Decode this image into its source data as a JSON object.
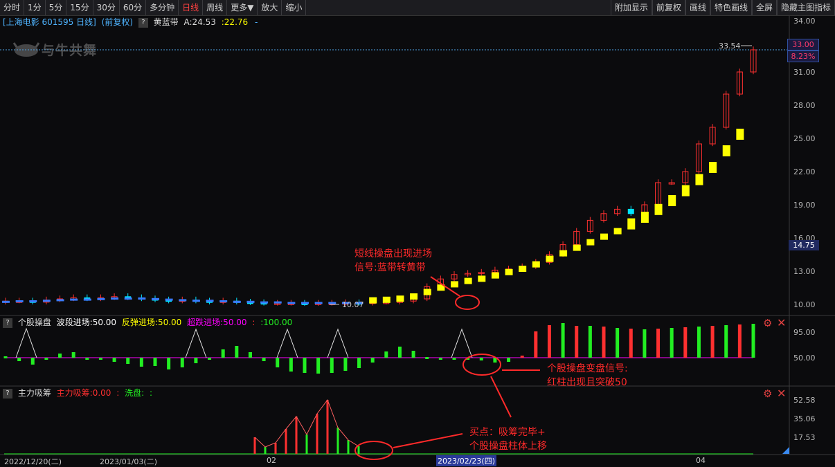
{
  "toolbar": {
    "left": [
      "分时",
      "1分",
      "5分",
      "15分",
      "30分",
      "60分",
      "多分钟",
      "日线",
      "周线",
      "更多▼",
      "放大",
      "缩小"
    ],
    "active": "日线",
    "right": [
      "附加显示",
      "前复权",
      "画线",
      "特色画线",
      "全屏",
      "隐藏主图指标"
    ]
  },
  "info": {
    "stock": "[上海电影 601595 日线]",
    "adj": "(前复权)",
    "q": "?",
    "indicator": "黄蓝带",
    "a": "A:24.53",
    "b": ":22.76",
    "c": "-"
  },
  "logo": "与牛共舞",
  "price_tags": {
    "top": "33.00",
    "pct": "8.23%",
    "mid": "14.75",
    "high_mark": "33.54",
    "low_mark": "10.07"
  },
  "axis_main": [
    "34.00",
    "31.00",
    "28.00",
    "25.00",
    "22.00",
    "19.00",
    "16.00",
    "13.00",
    "10.00"
  ],
  "panel2": {
    "q": "?",
    "name": "个股操盘",
    "s1": "波段进场:50.00",
    "s2": "反弹进场:50.00",
    "s3": "超跌进场:50.00",
    "s4": ":",
    "s5": ":100.00",
    "axis": [
      "95.00",
      "50.00"
    ]
  },
  "panel3": {
    "q": "?",
    "name": "主力吸筹",
    "s1": "主力吸筹:0.00",
    "s2": ":",
    "s3": "洗盘:",
    "s4": ":",
    "axis": [
      "52.58",
      "35.06",
      "17.53"
    ]
  },
  "dates": {
    "d1": "2022/12/20(二)",
    "d2": "2023/01/03(二)",
    "d3": "02",
    "d4": "2023/02/23(四)",
    "d5": "04"
  },
  "annotations": {
    "a1_line1": "短线操盘出现进场",
    "a1_line2": "信号:蓝带转黄带",
    "a2_line1": "个股操盘变盘信号:",
    "a2_line2": "红柱出现且突破50",
    "a3_line1": "买点：吸筹完毕+",
    "a3_line2": "个股操盘柱体上移"
  },
  "colors": {
    "up": "#ff3030",
    "down": "#00e5ff",
    "yellow": "#ffff00",
    "green": "#22ee22",
    "magenta": "#ff00ff",
    "annotation": "#ff2a2a"
  },
  "chart_data": {
    "type": "candlestick",
    "ylim": [
      10,
      34
    ],
    "close_series": [
      10.3,
      10.3,
      10.2,
      10.4,
      10.5,
      10.6,
      10.5,
      10.6,
      10.7,
      10.6,
      10.5,
      10.4,
      10.3,
      10.4,
      10.3,
      10.2,
      10.3,
      10.2,
      10.15,
      10.1,
      10.1,
      10.1,
      10.07,
      10.1,
      10.1,
      10.15,
      10.1,
      10.2,
      10.2,
      10.3,
      10.5,
      11.6,
      12.3,
      12.7,
      12.8,
      12.9,
      13.1,
      13.2,
      13.4,
      13.8,
      14.5,
      15.4,
      16.6,
      17.6,
      18.2,
      18.6,
      18.2,
      19.0,
      21.0,
      21.0,
      22.0,
      24.5,
      26.0,
      29.0,
      31.0,
      33.0
    ],
    "band_series": [
      10.2,
      10.25,
      10.25,
      10.3,
      10.35,
      10.4,
      10.4,
      10.45,
      10.5,
      10.5,
      10.5,
      10.45,
      10.4,
      10.35,
      10.3,
      10.3,
      10.25,
      10.2,
      10.2,
      10.15,
      10.15,
      10.1,
      10.1,
      10.1,
      10.1,
      10.1,
      10.1,
      10.15,
      10.2,
      10.3,
      10.5,
      10.9,
      11.3,
      11.6,
      11.9,
      12.1,
      12.4,
      12.7,
      13.0,
      13.4,
      13.9,
      14.4,
      14.9,
      15.4,
      15.9,
      16.4,
      16.9,
      17.5,
      18.2,
      19.0,
      19.9,
      20.9,
      22.0,
      23.5,
      25.0
    ]
  }
}
